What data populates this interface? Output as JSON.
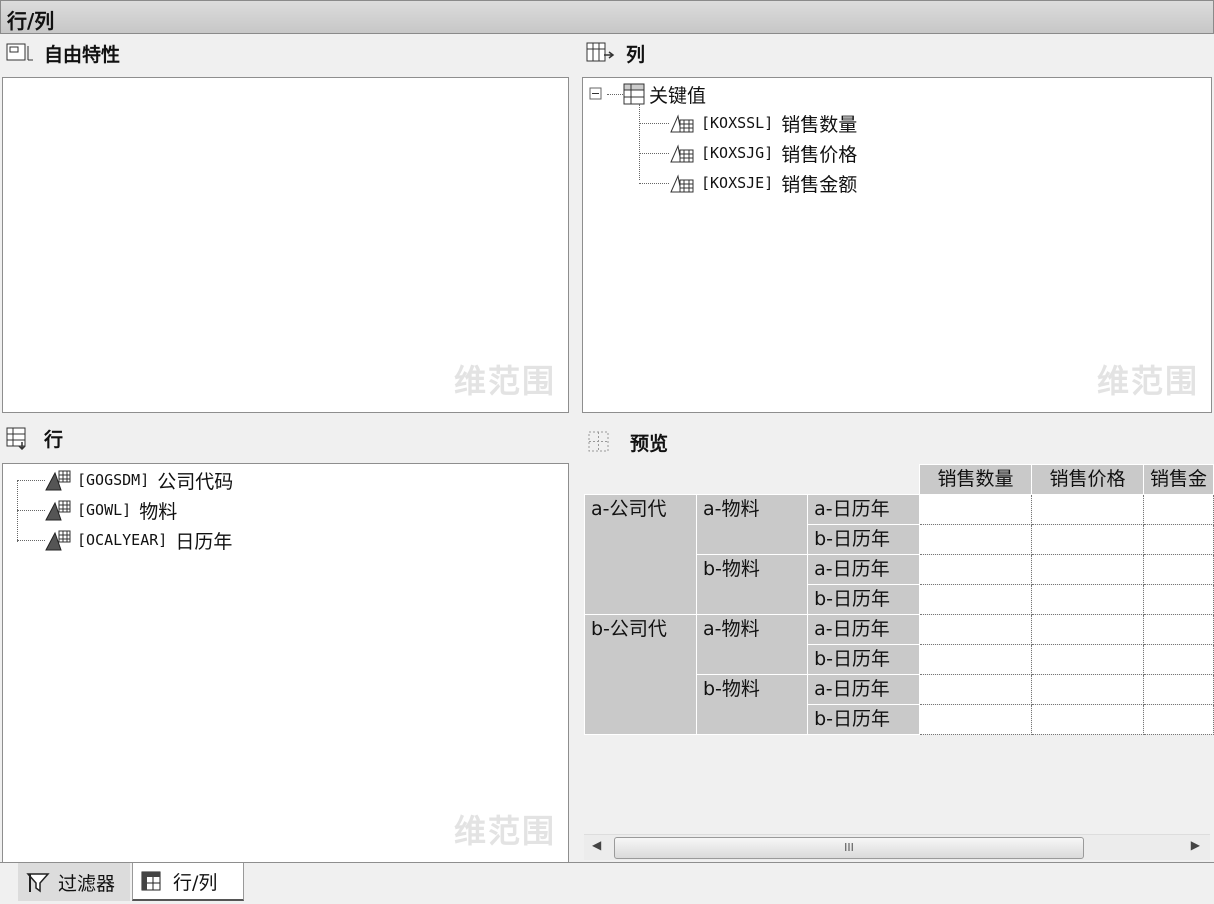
{
  "window": {
    "title": "行/列"
  },
  "free_chars": {
    "label": "自由特性",
    "watermark": "维范围"
  },
  "columns": {
    "label": "列",
    "root": "关键值",
    "items": [
      {
        "code": "[KOXSSL]",
        "name": "销售数量"
      },
      {
        "code": "[KOXSJG]",
        "name": "销售价格"
      },
      {
        "code": "[KOXSJE]",
        "name": "销售金额"
      }
    ],
    "watermark": "维范围"
  },
  "rows": {
    "label": "行",
    "items": [
      {
        "code": "[GOGSDM]",
        "name": "公司代码"
      },
      {
        "code": "[GOWL]",
        "name": "物料"
      },
      {
        "code": "[OCALYEAR]",
        "name": "日历年"
      }
    ],
    "watermark": "维范围"
  },
  "preview": {
    "label": "预览",
    "col_headers": [
      "销售数量",
      "销售价格",
      "销售金"
    ],
    "companies": [
      "a-公司代",
      "b-公司代"
    ],
    "materials": [
      "a-物料",
      "b-物料"
    ],
    "years": [
      "a-日历年",
      "b-日历年"
    ],
    "scroll_grip": "III"
  },
  "tabs": {
    "filter": "过滤器",
    "rowcol": "行/列"
  }
}
